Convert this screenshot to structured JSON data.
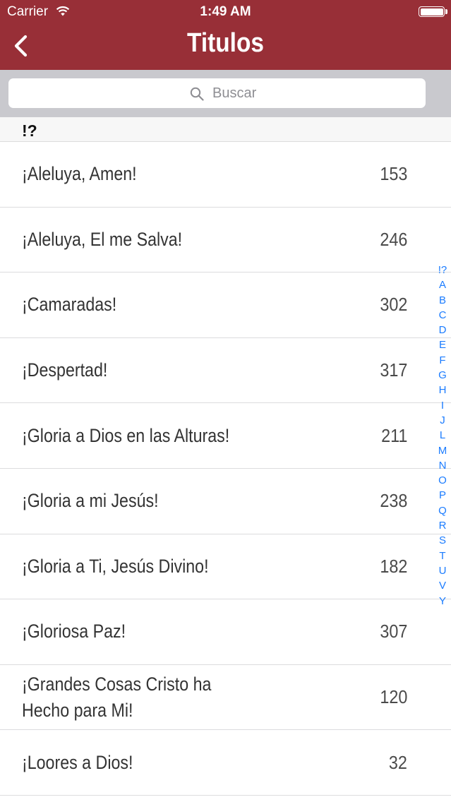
{
  "status_bar": {
    "carrier": "Carrier",
    "time": "1:49 AM"
  },
  "nav": {
    "title": "Titulos",
    "back_icon": "chevron-left-icon"
  },
  "search": {
    "placeholder": "Buscar",
    "icon": "search-icon"
  },
  "section": {
    "header": "!?"
  },
  "items": [
    {
      "title": "¡Aleluya, Amen!",
      "number": "153"
    },
    {
      "title": "¡Aleluya, El me Salva!",
      "number": "246"
    },
    {
      "title": "¡Camaradas!",
      "number": "302"
    },
    {
      "title": "¡Despertad!",
      "number": "317"
    },
    {
      "title": "¡Gloria a Dios en las Alturas!",
      "number": "211"
    },
    {
      "title": "¡Gloria a mi Jesús!",
      "number": "238"
    },
    {
      "title": "¡Gloria a Ti, Jesús Divino!",
      "number": "182"
    },
    {
      "title": "¡Gloriosa Paz!",
      "number": "307"
    },
    {
      "title": "¡Grandes Cosas Cristo ha Hecho para Mi!",
      "number": "120"
    },
    {
      "title": "¡Loores a Dios!",
      "number": "32"
    }
  ],
  "index_letters": [
    "!?",
    "A",
    "B",
    "C",
    "D",
    "E",
    "F",
    "G",
    "H",
    "I",
    "J",
    "L",
    "M",
    "N",
    "O",
    "P",
    "Q",
    "R",
    "S",
    "T",
    "U",
    "V",
    "Y"
  ],
  "colors": {
    "nav_background": "#982f37",
    "index_color": "#1b7cff",
    "search_background": "#c9c9ce"
  }
}
